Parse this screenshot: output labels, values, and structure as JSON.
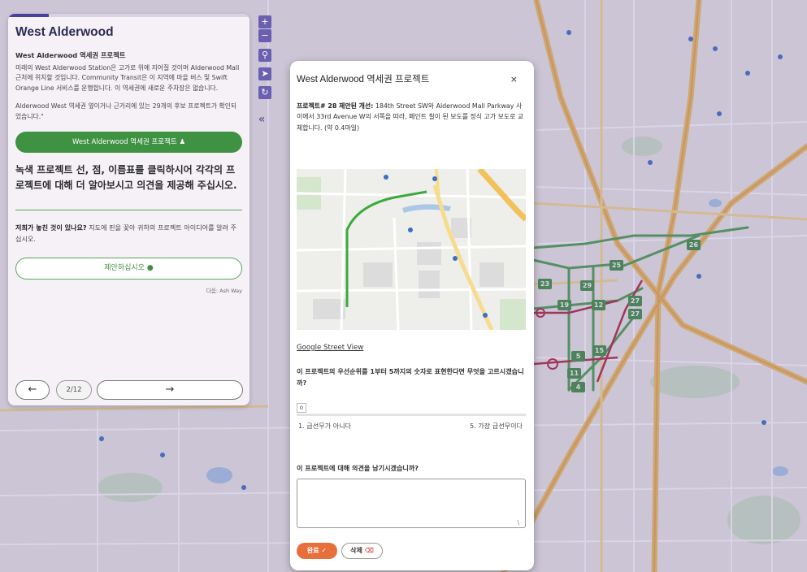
{
  "panel": {
    "title": "West Alderwood",
    "progress_fraction": 0.17,
    "subheading": "West Alderwood 역세권 프로젝트",
    "paragraph1": "미래의 West Alderwood Station은 고가로 위에 지어질 것이며 Alderwood Mall 근처에 위치할 것입니다. Community Transit은 이 지역에 마을 버스 및 Swift Orange Line 서비스를 운행합니다. 이 역세권에 새로운 주차장은 없습니다.",
    "paragraph2": "Alderwood West 역세권 옆이거나 근거리에 있는 29개의 후보 프로젝트가 확인되었습니다.\"",
    "project_button_label": "West Alderwood 역세권 프로젝트",
    "instruction": "녹색 프로젝트 선, 점, 이름표를 클릭하시어 각각의 프로젝트에 대해 더 알아보시고 의견을 제공해 주십시오.",
    "missed_bold": "저희가 놓친 것이 있나요?",
    "missed_text": " 지도에 핀을 꽂아 귀하의 프로젝트 아이디어를 알려 주십시오.",
    "suggest_button_label": "제안하십시오",
    "credit": "다음: Ash Way",
    "page_indicator": "2/12",
    "prev_arrow": "←",
    "next_arrow": "→"
  },
  "map_controls": {
    "zoom_in": "+",
    "zoom_out": "−",
    "collapse": "«"
  },
  "route_badges": [
    "26",
    "25",
    "23",
    "29",
    "19",
    "12",
    "27",
    "27",
    "15",
    "5",
    "11",
    "4"
  ],
  "popup": {
    "title": "West Alderwood 역세권 프로젝트",
    "close": "×",
    "desc_bold": "프로젝트# 28 제안된 개선:",
    "desc_text": " 184th Street SW와 Alderwood Mall Parkway 사이에서 33rd Avenue W의 서쪽을 따라, 페인트 칠이 된 보도를 정식 고가 보도로 교체합니다. (약 0.4마일)",
    "street_view_link": "Google Street View",
    "priority_question": "이 프로젝트의 우선순위를 1부터 5까지의 숫자로 표현한다면 무엇을 고르시겠습니까?",
    "slider_value": "0",
    "slider_min_label": "1. 급선무가 아니다",
    "slider_max_label": "5. 가장 급선무이다",
    "comment_question": "이 프로젝트에 대해 의견을 남기시겠습니까?",
    "comment_value": "",
    "done_label": "완료 ✓",
    "delete_label": "삭제"
  },
  "colors": {
    "panel_title": "#2b2b55",
    "green_button": "#3e9241",
    "done_button": "#e76f3c",
    "map_tint": "#7864aa"
  }
}
